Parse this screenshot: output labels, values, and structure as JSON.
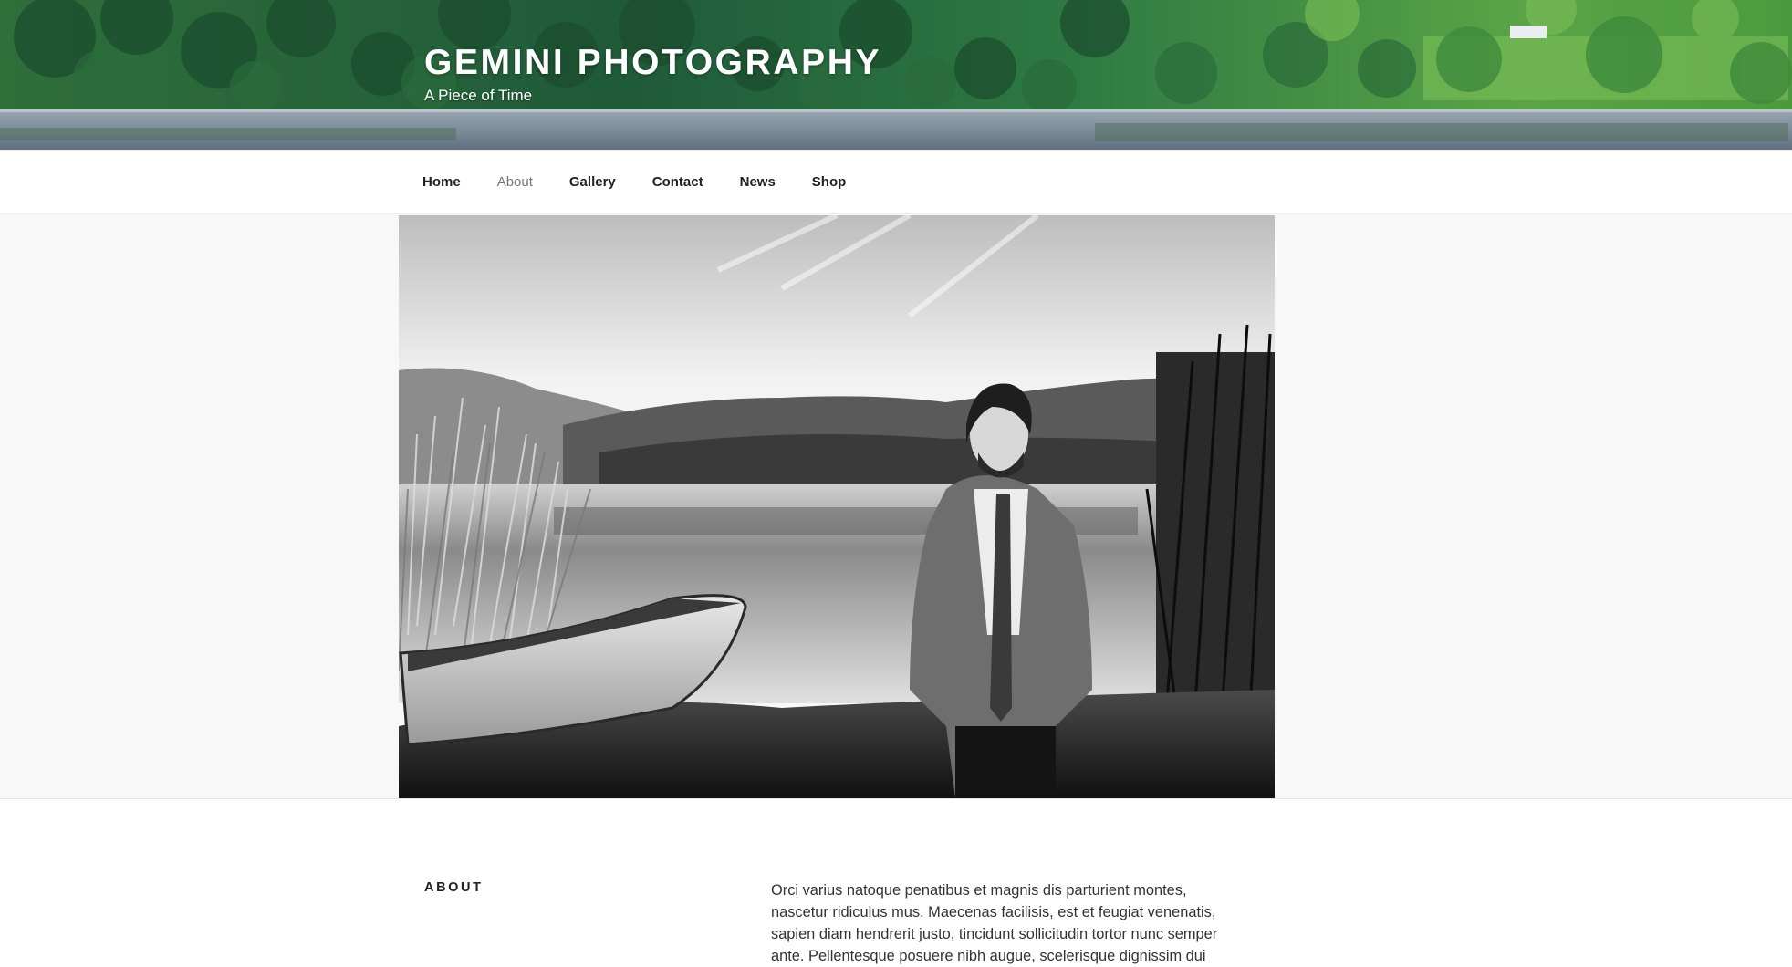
{
  "site": {
    "title": "GEMINI PHOTOGRAPHY",
    "tagline": "A Piece of Time"
  },
  "nav": {
    "items": [
      {
        "label": "Home",
        "current": false
      },
      {
        "label": "About",
        "current": true
      },
      {
        "label": "Gallery",
        "current": false
      },
      {
        "label": "Contact",
        "current": false
      },
      {
        "label": "News",
        "current": false
      },
      {
        "label": "Shop",
        "current": false
      }
    ]
  },
  "page": {
    "heading": "ABOUT",
    "body": "Orci varius natoque penatibus et magnis dis parturient montes, nascetur ridiculus mus. Maecenas facilisis, est et feugiat venenatis, sapien diam hendrerit justo, tincidunt sollicitudin tortor nunc semper ante. Pellentesque posuere nibh augue, scelerisque dignissim dui"
  },
  "colors": {
    "nav_current": "#767676",
    "text": "#222222",
    "hero_band": "#f8f8f8"
  }
}
